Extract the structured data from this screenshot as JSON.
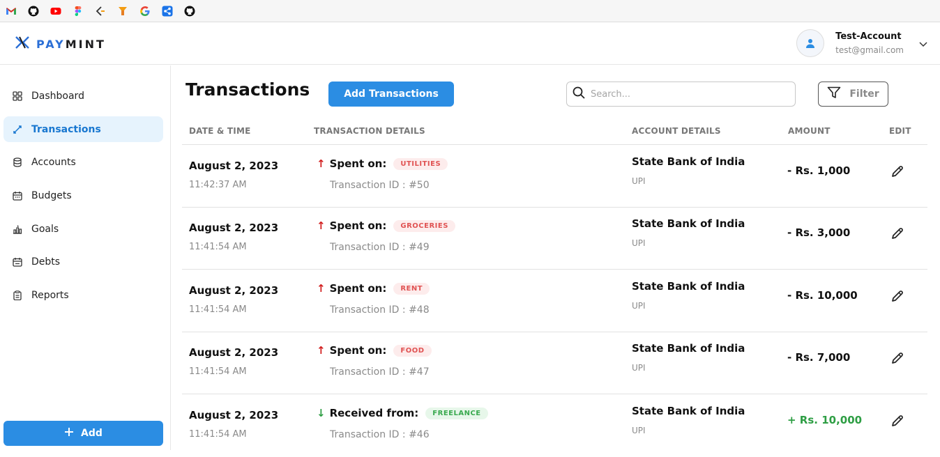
{
  "colors": {
    "brand": "#2b6fd6",
    "primary_button": "#2b8de3",
    "debit_arrow": "#d21f1f",
    "credit": "#2e9e44"
  },
  "bookmarks": [
    {
      "icon": "gmail-icon",
      "color": "#d93025"
    },
    {
      "icon": "github-icon",
      "color": "#111111"
    },
    {
      "icon": "youtube-icon",
      "color": "#ff0000"
    },
    {
      "icon": "figma-icon",
      "color": "#a259ff"
    },
    {
      "icon": "bookmark-icon-5",
      "color": "#444444"
    },
    {
      "icon": "bookmark-icon-6",
      "color": "#f39c12"
    },
    {
      "icon": "google-icon",
      "color": "#4285f4"
    },
    {
      "icon": "share-icon",
      "color": "#1a73e8"
    },
    {
      "icon": "github-icon",
      "color": "#111111"
    }
  ],
  "header": {
    "logo_pay": "PAY",
    "logo_mint": "MINT",
    "user_name": "Test-Account",
    "user_email": "test@gmail.com"
  },
  "sidebar": {
    "items": [
      {
        "label": "Dashboard",
        "icon": "grid-icon",
        "active": false
      },
      {
        "label": "Transactions",
        "icon": "transfer-icon",
        "active": true
      },
      {
        "label": "Accounts",
        "icon": "database-icon",
        "active": false
      },
      {
        "label": "Budgets",
        "icon": "calendar-icon",
        "active": false
      },
      {
        "label": "Goals",
        "icon": "goal-chart-icon",
        "active": false
      },
      {
        "label": "Debts",
        "icon": "calendar-icon",
        "active": false
      },
      {
        "label": "Reports",
        "icon": "clipboard-icon",
        "active": false
      }
    ],
    "add_label": "Add"
  },
  "main": {
    "title": "Transactions",
    "add_button": "Add Transactions",
    "search_placeholder": "Search...",
    "filter_label": "Filter",
    "columns": {
      "date": "DATE & TIME",
      "details": "TRANSACTION DETAILS",
      "account": "ACCOUNT DETAILS",
      "amount": "AMOUNT",
      "edit": "EDIT"
    },
    "rows": [
      {
        "date": "August 2, 2023",
        "time": "11:42:37 AM",
        "direction": "debit",
        "arrow": "↑",
        "label": "Spent on:",
        "tag": "UTILITIES",
        "txid": "Transaction ID : #50",
        "bank": "State Bank of India",
        "mode": "UPI",
        "amount": "- Rs. 1,000"
      },
      {
        "date": "August 2, 2023",
        "time": "11:41:54 AM",
        "direction": "debit",
        "arrow": "↑",
        "label": "Spent on:",
        "tag": "GROCERIES",
        "txid": "Transaction ID : #49",
        "bank": "State Bank of India",
        "mode": "UPI",
        "amount": "- Rs. 3,000"
      },
      {
        "date": "August 2, 2023",
        "time": "11:41:54 AM",
        "direction": "debit",
        "arrow": "↑",
        "label": "Spent on:",
        "tag": "RENT",
        "txid": "Transaction ID : #48",
        "bank": "State Bank of India",
        "mode": "UPI",
        "amount": "- Rs. 10,000"
      },
      {
        "date": "August 2, 2023",
        "time": "11:41:54 AM",
        "direction": "debit",
        "arrow": "↑",
        "label": "Spent on:",
        "tag": "FOOD",
        "txid": "Transaction ID : #47",
        "bank": "State Bank of India",
        "mode": "UPI",
        "amount": "- Rs. 7,000"
      },
      {
        "date": "August 2, 2023",
        "time": "11:41:54 AM",
        "direction": "credit",
        "arrow": "↓",
        "label": "Received from:",
        "tag": "FREELANCE",
        "txid": "Transaction ID : #46",
        "bank": "State Bank of India",
        "mode": "UPI",
        "amount": "+ Rs. 10,000"
      }
    ]
  }
}
